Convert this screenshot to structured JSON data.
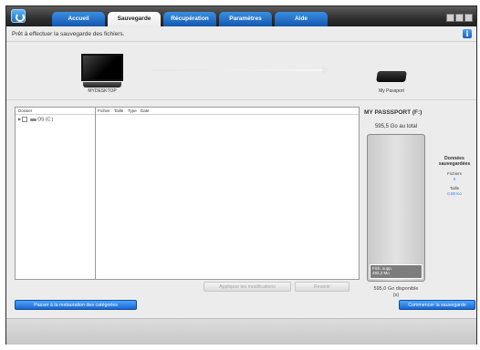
{
  "header": {
    "tabs": [
      {
        "label": "Accueil"
      },
      {
        "label": "Sauvegarde"
      },
      {
        "label": "Récupération"
      },
      {
        "label": "Paramètres"
      },
      {
        "label": "Aide"
      }
    ],
    "active_tab": "Sauvegarde"
  },
  "status": {
    "text": "Prêt à effectuer la sauvegarde des fichiers."
  },
  "source": {
    "label": "MYDESKTOP"
  },
  "target": {
    "label": "My Passport"
  },
  "browser": {
    "columns": [
      "Dossier",
      "Fichier",
      "Taille",
      "Type",
      "Date"
    ],
    "tree": [
      {
        "label": "OS (C:)"
      }
    ]
  },
  "buttons": {
    "apply": "Appliquer les modifications",
    "revert": "Revenir",
    "restore_categories": "Passer à la restauration des catégories",
    "start_backup": "Commencer la sauvegarde"
  },
  "drive_panel": {
    "title": "MY PASSSPORT (F:)",
    "capacity": "595,5 Go au total",
    "free_label_line1": "Fich. supp.",
    "free_label_line2": "492,2 Mo",
    "available_line1": "595,0 Go disponible",
    "available_line2": "(s)",
    "stats_title_line1": "Données",
    "stats_title_line2": "sauvegardées",
    "files_label": "Fichiers",
    "files_value": "0",
    "size_label": "Taille",
    "size_value": "0.00 Ko"
  },
  "colors": {
    "accent": "#1866d0",
    "tab_blue": "#2f7fd8",
    "stat_value": "#2a7ae8"
  },
  "icons": {
    "app": "wd-logo-icon",
    "info": "info-icon",
    "source": "monitor-icon",
    "target": "external-drive-icon"
  }
}
